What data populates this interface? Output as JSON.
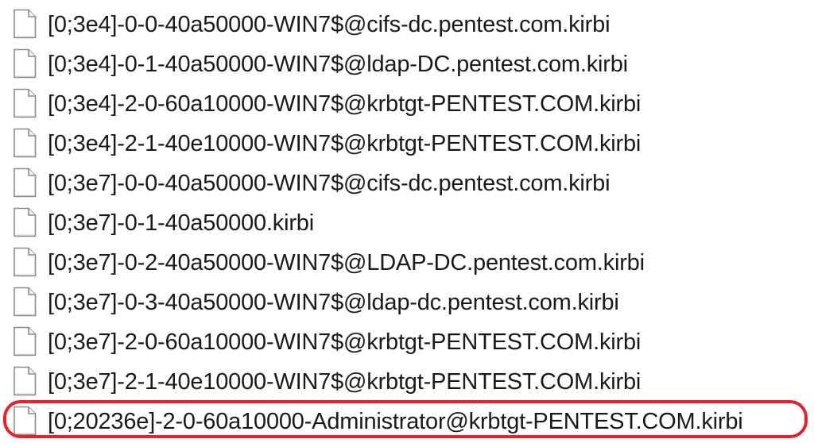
{
  "files": [
    {
      "name": "[0;3e4]-0-0-40a50000-WIN7$@cifs-dc.pentest.com.kirbi",
      "icon": "file-icon"
    },
    {
      "name": "[0;3e4]-0-1-40a50000-WIN7$@ldap-DC.pentest.com.kirbi",
      "icon": "file-icon"
    },
    {
      "name": "[0;3e4]-2-0-60a10000-WIN7$@krbtgt-PENTEST.COM.kirbi",
      "icon": "file-icon"
    },
    {
      "name": "[0;3e4]-2-1-40e10000-WIN7$@krbtgt-PENTEST.COM.kirbi",
      "icon": "file-icon"
    },
    {
      "name": "[0;3e7]-0-0-40a50000-WIN7$@cifs-dc.pentest.com.kirbi",
      "icon": "file-icon"
    },
    {
      "name": "[0;3e7]-0-1-40a50000.kirbi",
      "icon": "file-icon"
    },
    {
      "name": "[0;3e7]-0-2-40a50000-WIN7$@LDAP-DC.pentest.com.kirbi",
      "icon": "file-icon"
    },
    {
      "name": "[0;3e7]-0-3-40a50000-WIN7$@ldap-dc.pentest.com.kirbi",
      "icon": "file-icon"
    },
    {
      "name": "[0;3e7]-2-0-60a10000-WIN7$@krbtgt-PENTEST.COM.kirbi",
      "icon": "file-icon"
    },
    {
      "name": "[0;3e7]-2-1-40e10000-WIN7$@krbtgt-PENTEST.COM.kirbi",
      "icon": "file-icon"
    },
    {
      "name": "[0;20236e]-2-0-60a10000-Administrator@krbtgt-PENTEST.COM.kirbi",
      "icon": "file-icon",
      "highlighted": true
    }
  ],
  "colors": {
    "highlight": "#e8202a",
    "text": "#1a1a1a",
    "icon_stroke": "#8a8a8a"
  }
}
